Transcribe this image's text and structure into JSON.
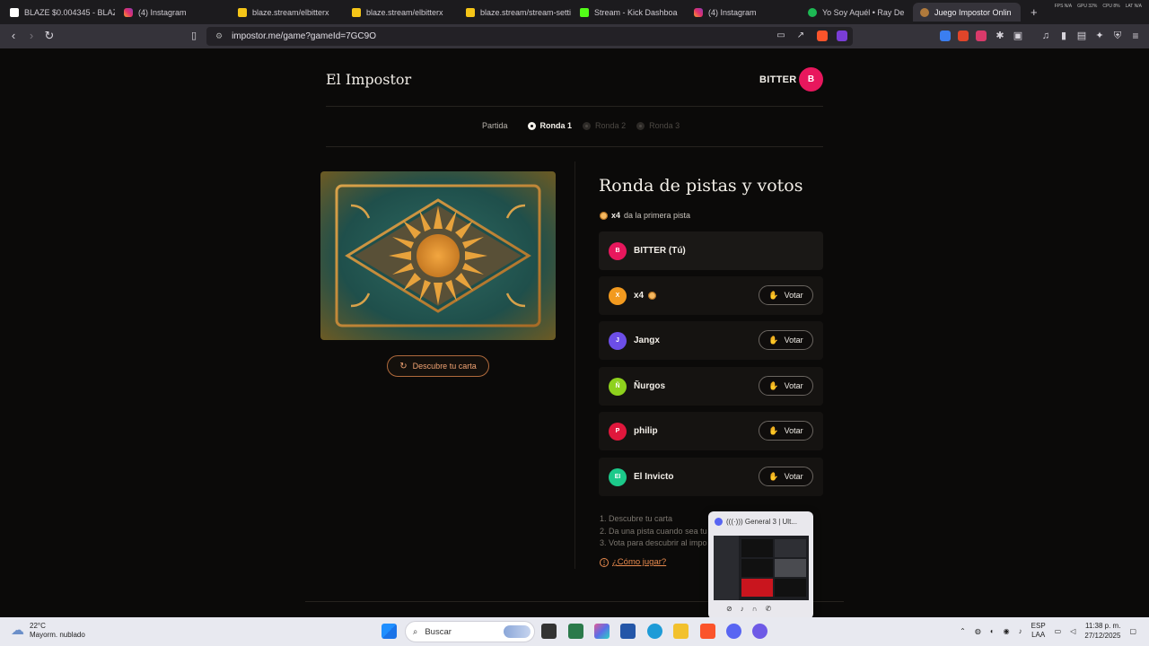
{
  "browser": {
    "tabs": [
      {
        "title": "BLAZE $0.004345 - BLAZE",
        "icon": "blaze-icon",
        "color": "#ffffff"
      },
      {
        "title": "(4) Instagram",
        "icon": "instagram-icon",
        "color": "#e1306c"
      },
      {
        "title": "blaze.stream/elbitterx",
        "icon": "blaze-icon",
        "color": "#f5c518"
      },
      {
        "title": "blaze.stream/elbitterx",
        "icon": "blaze-icon",
        "color": "#f5c518"
      },
      {
        "title": "blaze.stream/stream-settin",
        "icon": "blaze-icon",
        "color": "#f5c518"
      },
      {
        "title": "Stream - Kick Dashboa",
        "icon": "kick-icon",
        "color": "#53fc18"
      },
      {
        "title": "(4) Instagram",
        "icon": "instagram-icon",
        "color": "#e1306c"
      },
      {
        "title": "Yo Soy Aquél • Ray De",
        "icon": "spotify-icon",
        "color": "#1db954"
      },
      {
        "title": "Juego Impostor Onlin",
        "icon": "impostor-icon",
        "color": "#b07a3c"
      }
    ],
    "new_tab": "+",
    "stats": [
      "FPS N/A",
      "GPU 32%",
      "CPU 8%",
      "LAT N/A"
    ],
    "url": "impostor.me/game?gameId=7GC9O"
  },
  "page": {
    "brand": "El Impostor",
    "user": {
      "name": "BITTER",
      "initial": "B",
      "color": "#e8175d"
    },
    "stepper": {
      "label": "Partida",
      "steps": [
        {
          "label": "Ronda 1",
          "state": "current"
        },
        {
          "label": "Ronda 2",
          "state": "upcoming"
        },
        {
          "label": "Ronda 3",
          "state": "upcoming"
        }
      ]
    },
    "reveal_button": "Descubre tu carta",
    "round_title": "Ronda de pistas y votos",
    "first_clue": {
      "player": "x4",
      "text": "da la primera pista"
    },
    "vote_label": "Votar",
    "players": [
      {
        "name": "BITTER (Tú)",
        "initial": "B",
        "color": "#e8175d",
        "me": true
      },
      {
        "name": "x4",
        "initial": "X",
        "color": "#f29a1f",
        "first": true
      },
      {
        "name": "Jangx",
        "initial": "J",
        "color": "#6c4ee8"
      },
      {
        "name": "Ñurgos",
        "initial": "Ñ",
        "color": "#8ed11d"
      },
      {
        "name": "philip",
        "initial": "P",
        "color": "#e0173c"
      },
      {
        "name": "El Invicto",
        "initial": "EI",
        "color": "#1cc98a"
      }
    ],
    "instructions": [
      "1. Descubre tu carta",
      "2. Da una pista cuando sea tu",
      "3. Vota para descubrir al impo"
    ],
    "how_to_play": "¿Cómo jugar?"
  },
  "preview": {
    "title": "(((·))) General 3 | Ult..."
  },
  "taskbar": {
    "weather_temp": "22°C",
    "weather_desc": "Mayorm. nublado",
    "search_placeholder": "Buscar",
    "lang": "ESP",
    "lang_sub": "LAA",
    "time": "11:38 p. m.",
    "date": "27/12/2025"
  }
}
